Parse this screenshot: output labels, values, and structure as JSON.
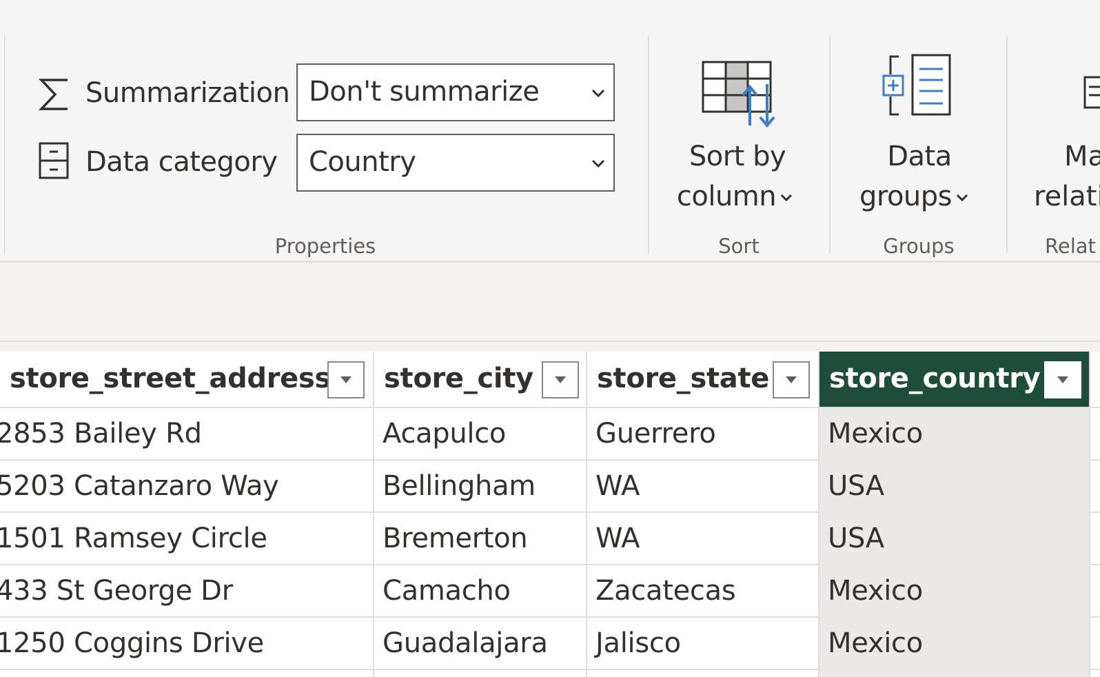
{
  "ribbon": {
    "properties": {
      "summarization_label": "Summarization",
      "summarization_value": "Don't summarize",
      "data_category_label": "Data category",
      "data_category_value": "Country",
      "group_label": "Properties"
    },
    "sort": {
      "button_line1": "Sort by",
      "button_line2": "column",
      "group_label": "Sort"
    },
    "groups": {
      "button_line1": "Data",
      "button_line2": "groups",
      "group_label": "Groups"
    },
    "relationships": {
      "button_line1": "Ma",
      "button_line2": "relati",
      "group_label": "Relat"
    }
  },
  "table": {
    "columns": [
      "store_street_address",
      "store_city",
      "store_state",
      "store_country"
    ],
    "selected_column": "store_country",
    "rows": [
      [
        "2853 Bailey Rd",
        "Acapulco",
        "Guerrero",
        "Mexico"
      ],
      [
        "5203 Catanzaro Way",
        "Bellingham",
        "WA",
        "USA"
      ],
      [
        "1501 Ramsey Circle",
        "Bremerton",
        "WA",
        "USA"
      ],
      [
        "433 St George Dr",
        "Camacho",
        "Zacatecas",
        "Mexico"
      ],
      [
        "1250 Coggins Drive",
        "Guadalajara",
        "Jalisco",
        "Mexico"
      ]
    ]
  },
  "colors": {
    "selected_header": "#1e4d3b",
    "selected_column_bg": "#ebe9e7",
    "ribbon_bg": "#f5f5f5",
    "icon_blue": "#3d7cc9"
  },
  "icons": [
    "sigma-icon",
    "data-category-icon",
    "chevron-down-icon",
    "sort-by-column-icon",
    "data-groups-icon",
    "manage-relationships-icon",
    "filter-dropdown-icon"
  ]
}
